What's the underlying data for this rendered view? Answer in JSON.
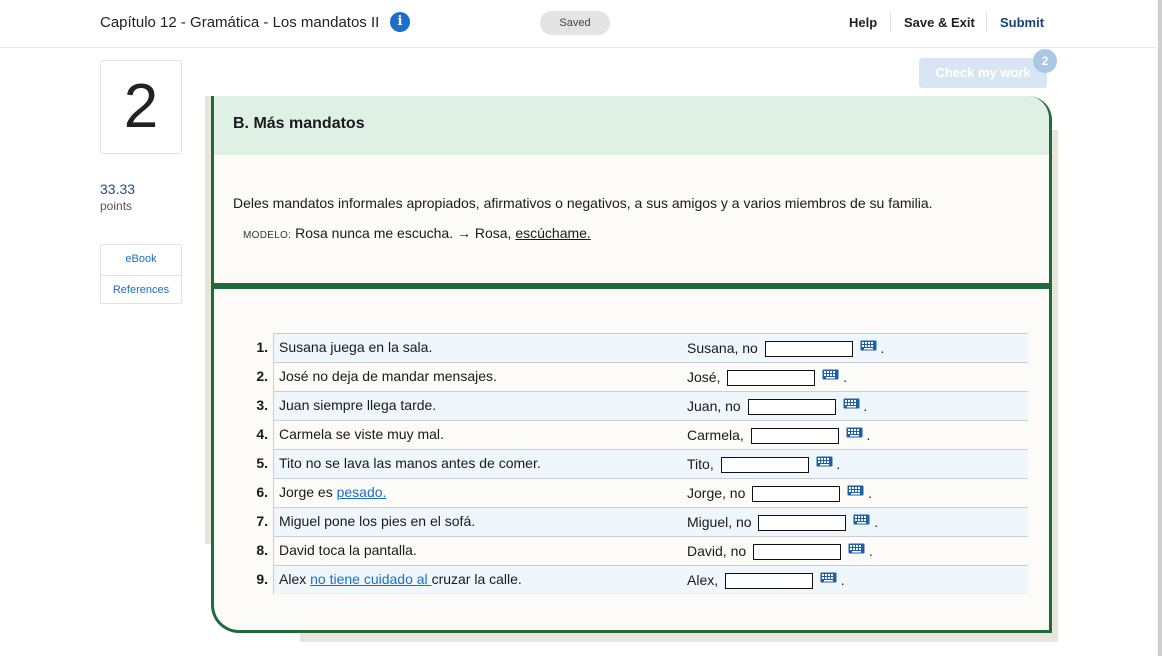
{
  "header": {
    "title": "Capítulo 12 - Gramática - Los mandatos II",
    "saved_status": "Saved",
    "help_label": "Help",
    "save_exit_label": "Save & Exit",
    "submit_label": "Submit"
  },
  "sidebar": {
    "question_number": "2",
    "points_value": "33.33",
    "points_label": "points",
    "links": [
      {
        "label": "eBook"
      },
      {
        "label": "References"
      }
    ]
  },
  "check_work": {
    "label": "Check my work",
    "badge": "2"
  },
  "exercise": {
    "section_title": "B. Más mandatos",
    "instructions": "Deles mandatos informales apropiados, afirmativos o negativos, a sus amigos y a varios miembros de su familia.",
    "modelo_tag": "MODELO:",
    "modelo_text": "Rosa nunca me escucha. → Rosa,",
    "modelo_answer": "escúchame.",
    "items": [
      {
        "num": "1.",
        "stmt_before": "Susana juega en la sala.",
        "resp_prefix": "Susana, no",
        "value": ""
      },
      {
        "num": "2.",
        "stmt_before": "José no deja de mandar mensajes.",
        "resp_prefix": "José,",
        "value": ""
      },
      {
        "num": "3.",
        "stmt_before": "Juan siempre llega tarde.",
        "resp_prefix": "Juan, no",
        "value": ""
      },
      {
        "num": "4.",
        "stmt_before": "Carmela se viste muy mal.",
        "resp_prefix": "Carmela,",
        "value": ""
      },
      {
        "num": "5.",
        "stmt_before": "Tito no se lava las manos antes de comer.",
        "resp_prefix": "Tito,",
        "value": ""
      },
      {
        "num": "6.",
        "stmt_before": "Jorge es ",
        "stmt_link": "pesado. ",
        "resp_prefix": "Jorge, no",
        "value": ""
      },
      {
        "num": "7.",
        "stmt_before": "Miguel pone los pies en el sofá.",
        "resp_prefix": "Miguel, no",
        "value": ""
      },
      {
        "num": "8.",
        "stmt_before": "David toca la pantalla.",
        "resp_prefix": "David, no",
        "value": ""
      },
      {
        "num": "9.",
        "stmt_before": "Alex ",
        "stmt_link": "no tiene cuidado ",
        "stmt_link2": "al ",
        "stmt_after": " cruzar la calle.",
        "resp_prefix": "Alex,",
        "value": ""
      }
    ],
    "period": "."
  },
  "colors": {
    "accent_green": "#1f6b3c",
    "header_band": "#dff1e5",
    "link_blue": "#1a6fc9",
    "submit_navy": "#1a3f7a"
  }
}
